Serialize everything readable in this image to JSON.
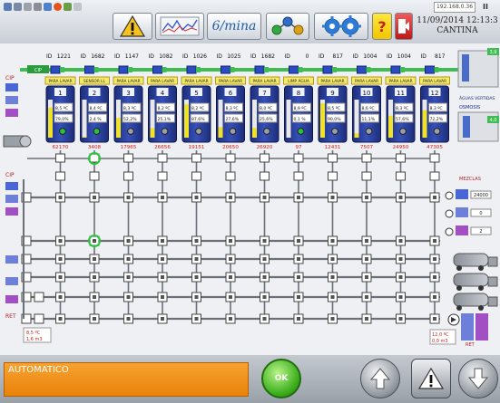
{
  "header": {
    "ip_address": "192.168.0.36",
    "pause_symbol": "II",
    "date_time": "11/09/2014 12:13:3",
    "location": "CANTINA",
    "mixing_label": "6/mina",
    "help_symbol": "?"
  },
  "tanks": [
    {
      "code": "1221",
      "state": "PARA LAVAR",
      "number": "1",
      "temp": "8,5 ºC",
      "level": "79,0%",
      "volume": "62170",
      "valve": "green"
    },
    {
      "code": "1682",
      "state": "SENSOR LL",
      "number": "2",
      "temp": "8,4 ºC",
      "level": "2,4 %",
      "volume": "3408",
      "valve": "green"
    },
    {
      "code": "1147",
      "state": "PARA LAVAR",
      "number": "3",
      "temp": "8,3 ºC",
      "level": "52,2%",
      "volume": "17965",
      "valve": "grey"
    },
    {
      "code": "1082",
      "state": "PARA LAVAR",
      "number": "4",
      "temp": "8,2 ºC",
      "level": "25,1%",
      "volume": "26656",
      "valve": "grey"
    },
    {
      "code": "1026",
      "state": "PARA LAVAR",
      "number": "5",
      "temp": "8,2 ºC",
      "level": "87,6%",
      "volume": "19151",
      "valve": "grey"
    },
    {
      "code": "1025",
      "state": "PARA LAVAR",
      "number": "6",
      "temp": "8,3 ºC",
      "level": "27,6%",
      "volume": "20650",
      "valve": "grey"
    },
    {
      "code": "1682",
      "state": "PARA LAVAR",
      "number": "7",
      "temp": "8,0 ºC",
      "level": "25,6%",
      "volume": "26920",
      "valve": "grey"
    },
    {
      "code": "0",
      "state": "LIMP ÁGUA",
      "number": "8",
      "temp": "8,9 ºC",
      "level": "0,1 %",
      "volume": "97",
      "valve": "green"
    },
    {
      "code": "817",
      "state": "PARA LAVAR",
      "number": "9",
      "temp": "8,5 ºC",
      "level": "90,0%",
      "volume": "12431",
      "valve": "grey"
    },
    {
      "code": "1004",
      "state": "PARA LAVAR",
      "number": "10",
      "temp": "8,6 ºC",
      "level": "11,1%",
      "volume": "7507",
      "valve": "grey"
    },
    {
      "code": "1004",
      "state": "PARA LAVAR",
      "number": "11",
      "temp": "8,3 ºC",
      "level": "57,6%",
      "volume": "24950",
      "valve": "grey"
    },
    {
      "code": "817",
      "state": "PARA LAVAR",
      "number": "12",
      "temp": "8,3 ºC",
      "level": "72,2%",
      "volume": "47305",
      "valve": "grey"
    }
  ],
  "lines": {
    "id_prefix": "ID",
    "cip_top": "CIP",
    "cip_mid": "CIP",
    "ret": "RET",
    "cip_pump_badge": "CIP",
    "water_label": "ÁGUAS VERTIDAS",
    "osmosis_label": "OSMOSIS",
    "mix_label": "MEZCLAS",
    "mix_values": [
      "24000",
      "0",
      "2"
    ],
    "badge_top": "3,9",
    "badge_mid": "4,0",
    "bottom_left_temp": "8,5 ºC",
    "bottom_left_flow": "1,6 m3",
    "bottom_right_temp": "12,0 ºC",
    "bottom_right_flow": "0,0 m3",
    "ret_tag": "RET"
  },
  "footer": {
    "mode": "AUTOMATICO",
    "ok_label": "OK"
  },
  "colors": {
    "tank_blue": "#2a3c92",
    "pipe_grey": "#6b7078",
    "valve_green": "#27c43a",
    "alert_red": "#d21e1e",
    "footer_orange": "#f08c1a"
  }
}
